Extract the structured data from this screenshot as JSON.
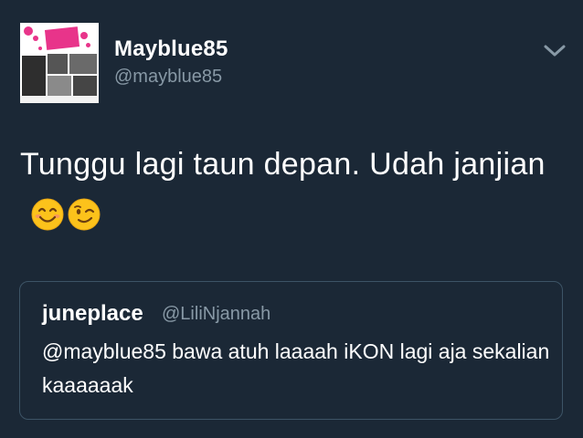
{
  "tweet": {
    "display_name": "Mayblue85",
    "handle": "@mayblue85",
    "text": "Tunggu lagi taun depan. Udah janjian",
    "emojis": [
      "smiling-face-emoji",
      "winking-face-emoji"
    ],
    "avatar_icon": "profile-collage-avatar",
    "menu_icon": "chevron-down-icon"
  },
  "quoted_tweet": {
    "display_name": "juneplace",
    "handle": "@LiliNjannah",
    "text": "@mayblue85 bawa atuh laaaah iKON lagi aja sekalian kaaaaaak"
  },
  "colors": {
    "background": "#1b2836",
    "secondary_text": "#8899a6",
    "quote_border": "#3d5466",
    "accent_pink": "#e8348a"
  }
}
